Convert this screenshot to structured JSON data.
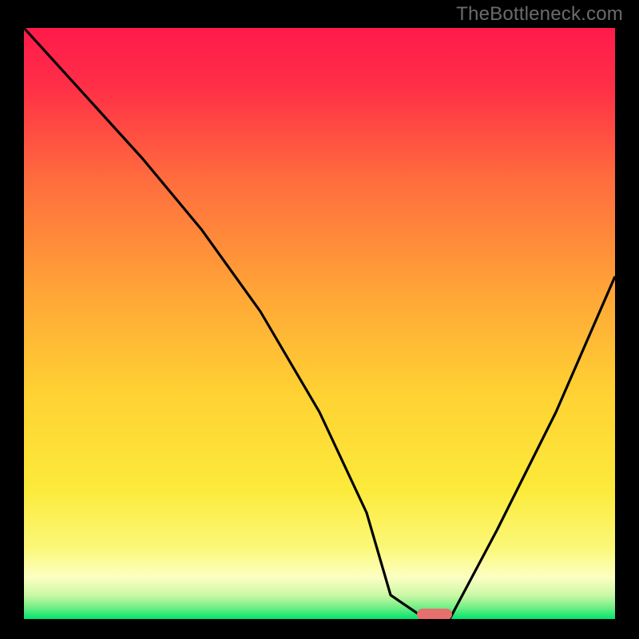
{
  "watermark": "TheBottleneck.com",
  "colors": {
    "top": "#ff1a4b",
    "mid": "#ffcf33",
    "pale": "#feffc5",
    "green": "#00e46b",
    "curve": "#000000",
    "pill": "#e76f6e",
    "bg": "#000000"
  },
  "chart_data": {
    "type": "line",
    "title": "",
    "xlabel": "",
    "ylabel": "",
    "xlim": [
      0,
      100
    ],
    "ylim": [
      0,
      100
    ],
    "series": [
      {
        "name": "bottleneck-curve",
        "x": [
          0,
          20,
          30,
          40,
          50,
          58,
          62,
          68,
          72,
          80,
          90,
          100
        ],
        "values": [
          100,
          78,
          66,
          52,
          35,
          18,
          4,
          0,
          0,
          15,
          35,
          58
        ]
      }
    ],
    "marker": {
      "name": "optimal-point-pill",
      "x": 70,
      "y": 0,
      "width": 6,
      "height": 2
    }
  }
}
